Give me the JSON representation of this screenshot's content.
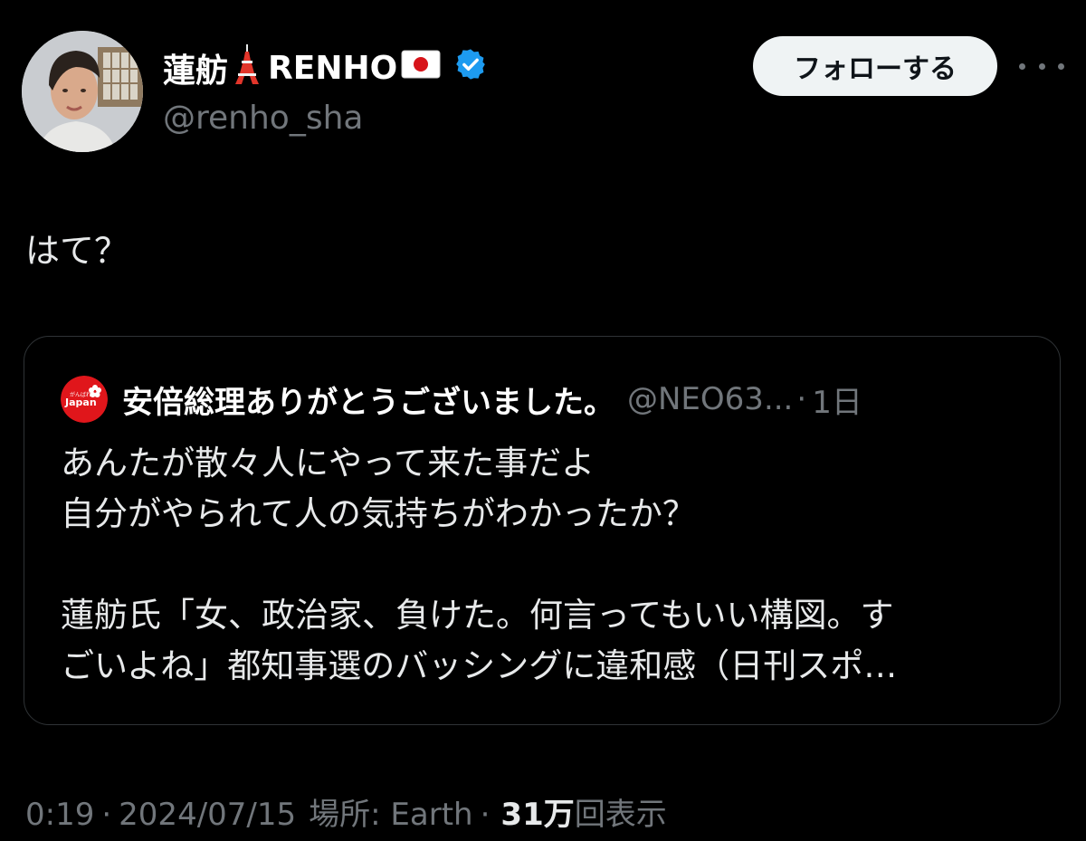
{
  "author": {
    "display_name_prefix": "蓮舫",
    "display_name_suffix": "RENHO",
    "tower_emoji": "tokyo-tower-icon",
    "flag_emoji": "japan-flag-icon",
    "verified": true,
    "handle": "@renho_sha"
  },
  "actions": {
    "follow_label": "フォローする",
    "more_icon": "more-horizontal-icon"
  },
  "tweet": {
    "text": "はて？"
  },
  "quoted_tweet": {
    "avatar_text": "Japan",
    "avatar_subtext": "がんばれ",
    "name": "安倍総理ありがとうございました。",
    "handle": "@NEO63...",
    "separator": "·",
    "time": "1日",
    "lines": [
      "あんたが散々人にやって来た事だよ",
      "自分がやられて人の気持ちがわかったか？",
      "",
      "蓮舫氏「女、政治家、負けた。何言ってもいい構図。す",
      "ごいよね」都知事選のバッシングに違和感（日刊スポ…"
    ]
  },
  "meta": {
    "time": "0:19",
    "sep1": "·",
    "date": "2024/07/15",
    "location": "場所: Earth",
    "sep2": "·",
    "views_count": "31万",
    "views_label": "回表示"
  },
  "colors": {
    "background": "#000000",
    "text_primary": "#e7e9ea",
    "text_secondary": "#71767b",
    "border": "#2f3336",
    "follow_bg": "#eff3f4",
    "verified_blue": "#1d9bf0",
    "quote_avatar_red": "#e0161b"
  }
}
